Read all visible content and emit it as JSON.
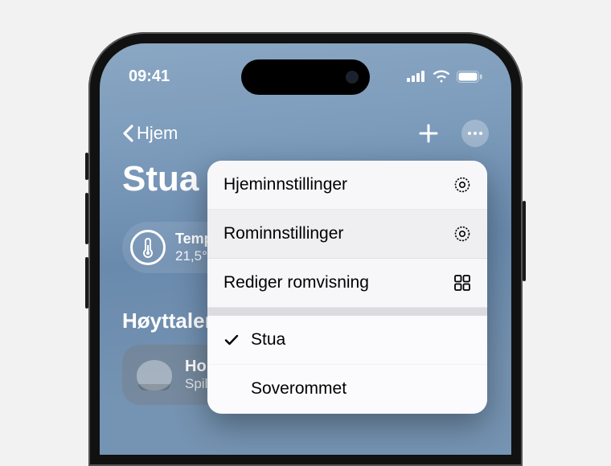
{
  "status": {
    "time": "09:41"
  },
  "nav": {
    "back_label": "Hjem"
  },
  "room": {
    "title": "Stua"
  },
  "temperature": {
    "label": "Temperatu",
    "value": "21,5°"
  },
  "section": {
    "speakers_heading": "Høyttalere og"
  },
  "tile": {
    "title": "HomePo",
    "subtitle": "Spiller ik"
  },
  "menu": {
    "home_settings": "Hjeminnstillinger",
    "room_settings": "Rominnstillinger",
    "edit_view": "Rediger romvisning",
    "rooms": [
      {
        "name": "Stua",
        "selected": true
      },
      {
        "name": "Soverommet",
        "selected": false
      }
    ]
  }
}
